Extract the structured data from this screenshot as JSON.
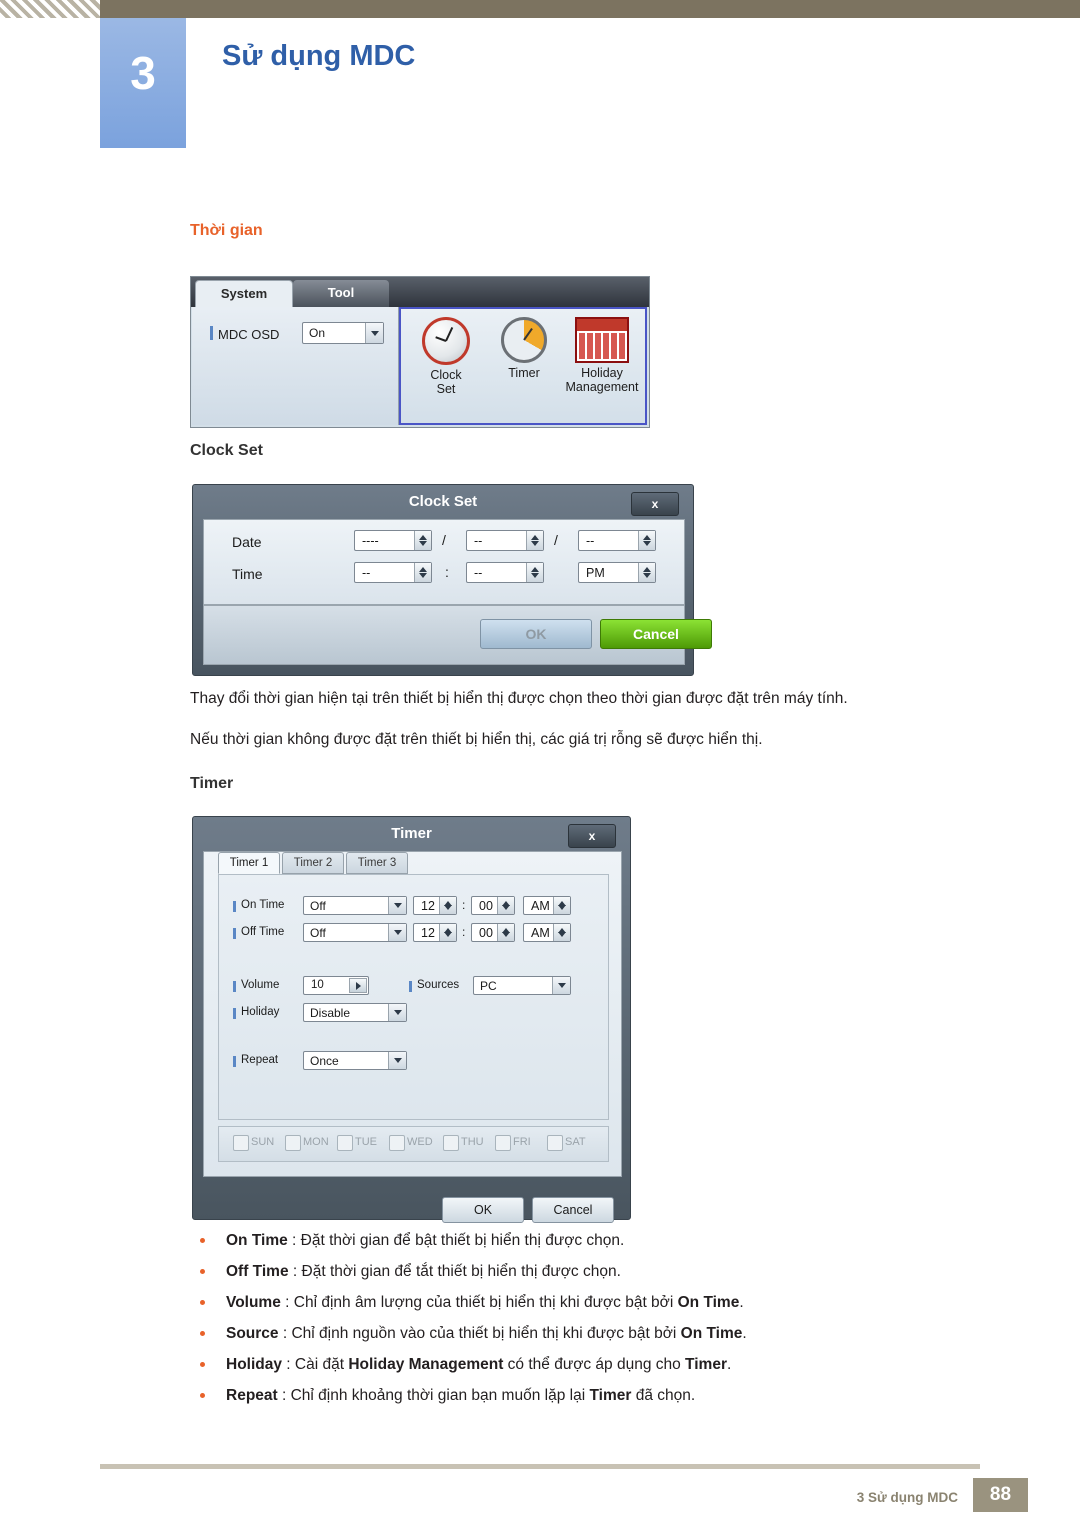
{
  "header": {
    "chapter_number": "3",
    "chapter_title": "Sử dụng MDC"
  },
  "section": {
    "title": "Thời gian",
    "clock_set_heading": "Clock Set",
    "timer_heading": "Timer",
    "paragraph1": "Thay đổi thời gian hiện tại trên thiết bị hiển thị được chọn theo thời gian được đặt trên máy tính.",
    "paragraph2": "Nếu thời gian không được đặt trên thiết bị hiển thị, các giá trị rỗng sẽ được hiển thị."
  },
  "figure_system_tool": {
    "tabs": [
      {
        "label": "System",
        "active": true
      },
      {
        "label": "Tool",
        "active": false
      }
    ],
    "osd_label": "MDC OSD",
    "osd_value": "On",
    "icons": [
      {
        "name": "clock-set-icon",
        "caption_line1": "Clock",
        "caption_line2": "Set"
      },
      {
        "name": "timer-icon",
        "caption_line1": "Timer",
        "caption_line2": ""
      },
      {
        "name": "holiday-management-icon",
        "caption_line1": "Holiday",
        "caption_line2": "Management"
      }
    ]
  },
  "clock_set_dialog": {
    "title": "Clock Set",
    "close_label": "x",
    "date_label": "Date",
    "time_label": "Time",
    "date_fields": [
      "----",
      "--",
      "--"
    ],
    "date_separator": "/",
    "time_fields": [
      "--",
      "--"
    ],
    "time_separator": ":",
    "meridiem": "PM",
    "ok_label": "OK",
    "cancel_label": "Cancel"
  },
  "timer_dialog": {
    "title": "Timer",
    "close_label": "x",
    "tabs": [
      "Timer 1",
      "Timer 2",
      "Timer 3"
    ],
    "rows": {
      "on_time_label": "On Time",
      "on_time_value": "Off",
      "on_time_hour": "12",
      "on_time_minute": "00",
      "on_time_meridiem": "AM",
      "off_time_label": "Off Time",
      "off_time_value": "Off",
      "off_time_hour": "12",
      "off_time_minute": "00",
      "off_time_meridiem": "AM",
      "volume_label": "Volume",
      "volume_value": "10",
      "sources_label": "Sources",
      "sources_value": "PC",
      "holiday_label": "Holiday",
      "holiday_value": "Disable",
      "repeat_label": "Repeat",
      "repeat_value": "Once",
      "time_separator": ":"
    },
    "days": [
      "SUN",
      "MON",
      "TUE",
      "WED",
      "THU",
      "FRI",
      "SAT"
    ],
    "ok_label": "OK",
    "cancel_label": "Cancel"
  },
  "bullets": [
    {
      "term": "On Time",
      "sep": " : ",
      "text": "Đặt thời gian để bật thiết bị hiển thị được chọn."
    },
    {
      "term": "Off Time",
      "sep": " : ",
      "text": "Đặt thời gian để tắt thiết bị hiển thị được chọn."
    },
    {
      "term": "Volume",
      "sep": " : ",
      "text_pre": "Chỉ định âm lượng của thiết bị hiển thị khi được bật bởi ",
      "strong": "On Time",
      "text_post": "."
    },
    {
      "term": "Source",
      "sep": " : ",
      "text_pre": "Chỉ định nguồn vào của thiết bị hiển thị khi được bật bởi ",
      "strong": "On Time",
      "text_post": "."
    },
    {
      "term": "Holiday",
      "sep": " : ",
      "text_pre": "Cài đặt ",
      "strong": "Holiday Management",
      "text_mid": " có thể được áp dụng cho ",
      "strong2": "Timer",
      "text_post": "."
    },
    {
      "term": "Repeat",
      "sep": " : ",
      "text_pre": "Chỉ định khoảng thời gian bạn muốn lặp lại ",
      "strong": "Timer",
      "text_post": " đã chọn."
    }
  ],
  "footer": {
    "text": "3 Sử dụng MDC",
    "page": "88"
  }
}
